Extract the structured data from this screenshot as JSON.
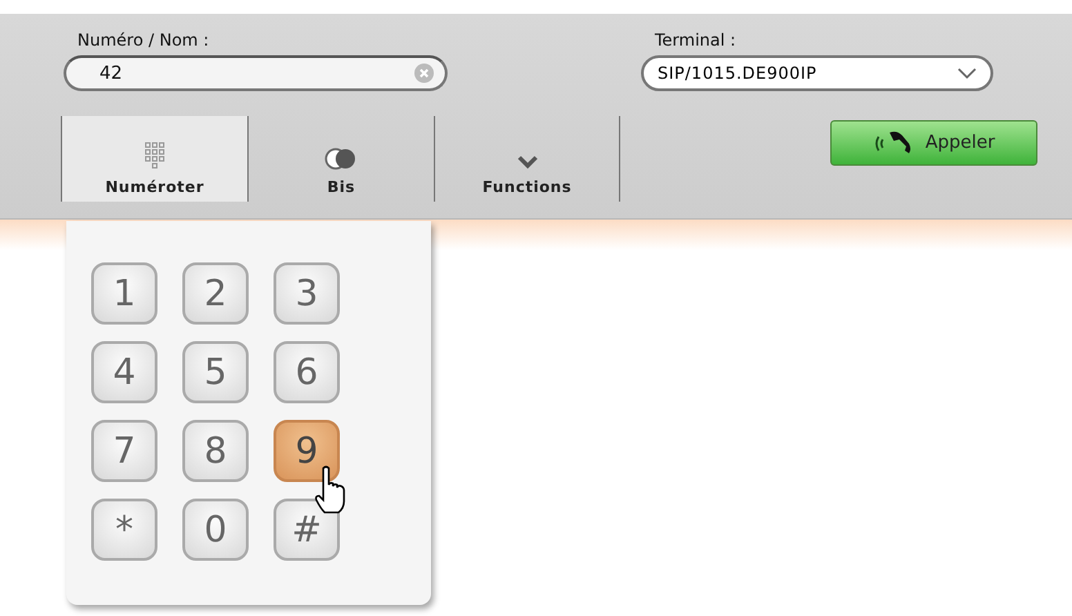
{
  "search": {
    "label": "Numéro / Nom :",
    "value": "42"
  },
  "terminal": {
    "label": "Terminal :",
    "value": "SIP/1015.DE900IP"
  },
  "tabs": [
    {
      "label": "Numéroter",
      "selected": true
    },
    {
      "label": "Bis",
      "selected": false
    },
    {
      "label": "Functions",
      "selected": false
    }
  ],
  "call_button": {
    "label": "Appeler"
  },
  "keypad": [
    {
      "label": "1",
      "hovered": false
    },
    {
      "label": "2",
      "hovered": false
    },
    {
      "label": "3",
      "hovered": false
    },
    {
      "label": "4",
      "hovered": false
    },
    {
      "label": "5",
      "hovered": false
    },
    {
      "label": "6",
      "hovered": false
    },
    {
      "label": "7",
      "hovered": false
    },
    {
      "label": "8",
      "hovered": false
    },
    {
      "label": "9",
      "hovered": true
    },
    {
      "label": "*",
      "hovered": false
    },
    {
      "label": "0",
      "hovered": false
    },
    {
      "label": "#",
      "hovered": false
    }
  ]
}
